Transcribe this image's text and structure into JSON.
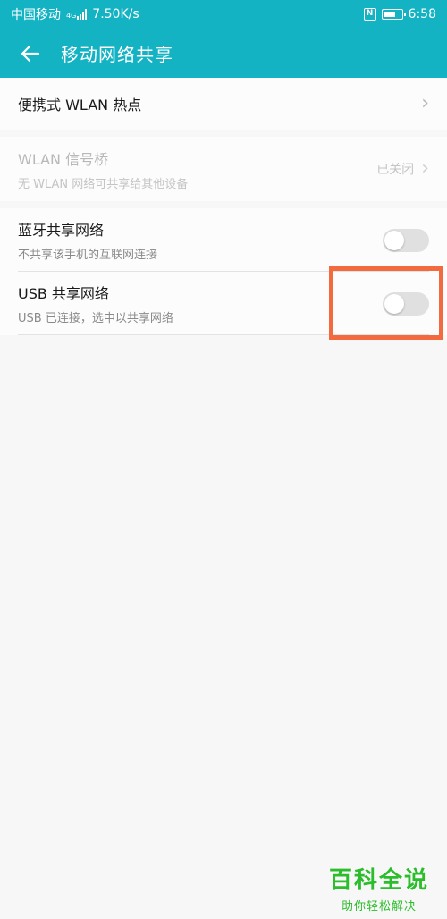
{
  "status_bar": {
    "carrier": "中国移动",
    "network_tag": "4G",
    "speed": "7.50K/s",
    "time": "6:58",
    "icons": [
      "signal-icon",
      "nfc-icon",
      "battery-icon"
    ]
  },
  "app_bar": {
    "title": "移动网络共享",
    "back_icon": "arrow-left-icon"
  },
  "items": {
    "hotspot": {
      "title": "便携式 WLAN 热点"
    },
    "wlan_bridge": {
      "title": "WLAN 信号桥",
      "subtitle": "无 WLAN 网络可共享给其他设备",
      "status": "已关闭",
      "enabled": false
    },
    "bluetooth": {
      "title": "蓝牙共享网络",
      "subtitle": "不共享该手机的互联网连接",
      "on": false
    },
    "usb": {
      "title": "USB 共享网络",
      "subtitle": "USB 已连接，选中以共享网络",
      "on": false
    }
  },
  "colors": {
    "accent": "#14b3c4",
    "highlight": "#f26a3d",
    "watermark": "#2bbd2b"
  },
  "watermark": {
    "title": "百科全说",
    "subtitle": "助你轻松解决"
  }
}
